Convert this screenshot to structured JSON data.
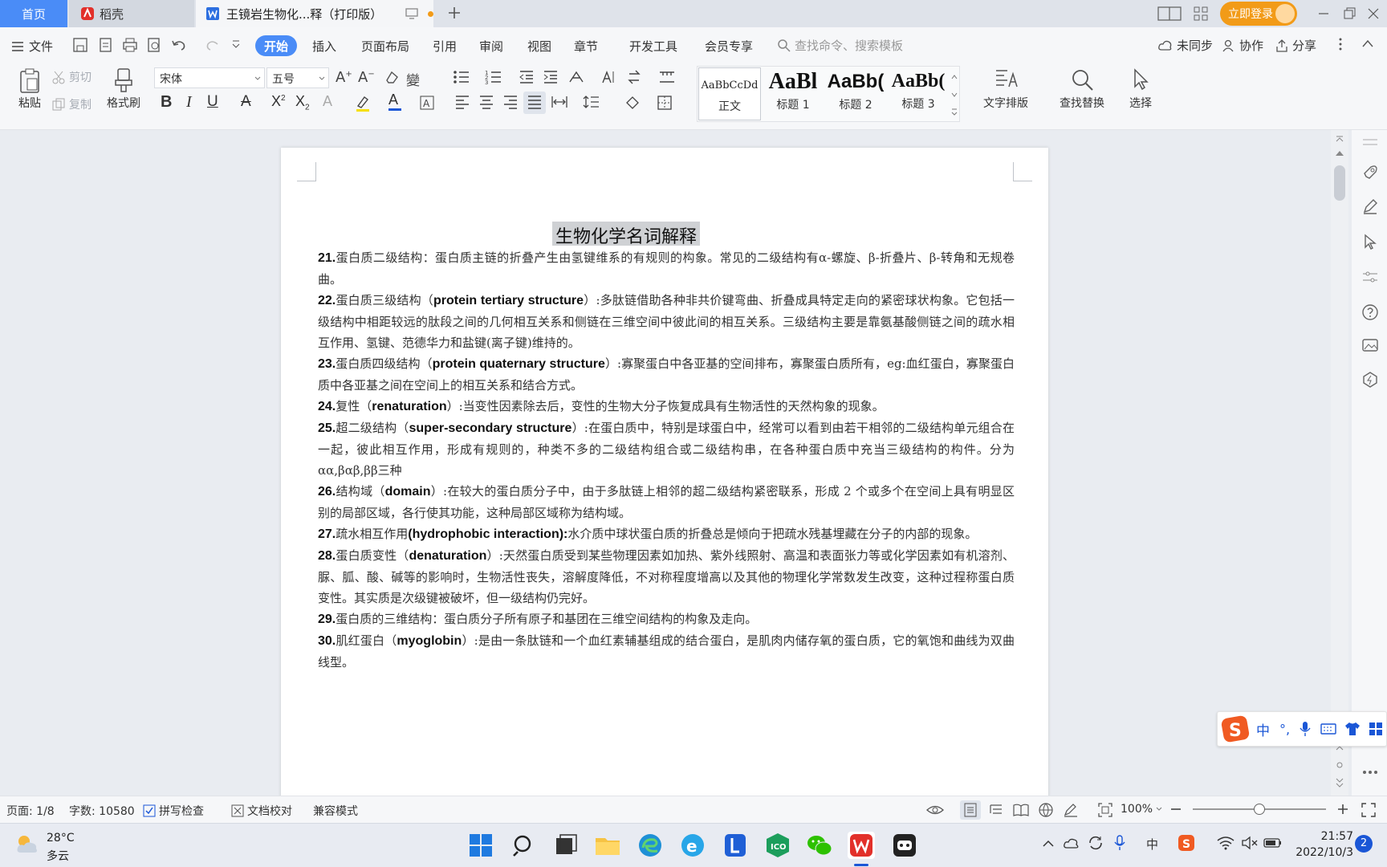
{
  "tabs": {
    "home": "首页",
    "daoke": "稻壳",
    "doc": "王镜岩生物化...释（打印版）",
    "login": "立即登录"
  },
  "menu": {
    "file": "文件",
    "items": [
      "开始",
      "插入",
      "页面布局",
      "引用",
      "审阅",
      "视图",
      "章节",
      "开发工具",
      "会员专享"
    ],
    "search_placeholder": "查找命令、搜索模板",
    "sync": "未同步",
    "collab": "协作",
    "share": "分享"
  },
  "ribbon": {
    "paste": "粘贴",
    "cut": "剪切",
    "copy": "复制",
    "format_painter": "格式刷",
    "font": "宋体",
    "size": "五号",
    "styles": [
      {
        "preview": "AaBbCcDd",
        "label": "正文"
      },
      {
        "preview": "AaBl",
        "label": "标题 1"
      },
      {
        "preview": "AaBb(",
        "label": "标题 2"
      },
      {
        "preview": "AaBb(",
        "label": "标题 3"
      }
    ],
    "text_layout": "文字排版",
    "find_replace": "查找替换",
    "select": "选择"
  },
  "document": {
    "title": "生物化学名词解释",
    "paragraphs": [
      {
        "num": "21.",
        "term": "蛋白质二级结构：",
        "en": "",
        "text": "蛋白质主链的折叠产生由氢键维系的有规则的构象。常见的二级结构有α-螺旋、β-折叠片、β-转角和无规卷曲。"
      },
      {
        "num": "22.",
        "term": "蛋白质三级结构（",
        "en": "protein tertiary structure",
        "text": "）:多肽链借助各种非共价键弯曲、折叠成具特定走向的紧密球状构象。它包括一级结构中相距较远的肽段之间的几何相互关系和侧链在三维空间中彼此间的相互关系。三级结构主要是靠氨基酸侧链之间的疏水相互作用、氢键、范德华力和盐键(离子键)维持的。"
      },
      {
        "num": "23.",
        "term": "蛋白质四级结构（",
        "en": "protein quaternary structure",
        "text": "）:寡聚蛋白中各亚基的空间排布，寡聚蛋白质所有，eg:血红蛋白，寡聚蛋白质中各亚基之间在空间上的相互关系和结合方式。"
      },
      {
        "num": "24.",
        "term": "复性（",
        "en": "renaturation",
        "text": "）:当变性因素除去后，变性的生物大分子恢复成具有生物活性的天然构象的现象。"
      },
      {
        "num": "25.",
        "term": "超二级结构（",
        "en": "super-secondary structure",
        "text": "）:在蛋白质中，特别是球蛋白中，经常可以看到由若干相邻的二级结构单元组合在一起，彼此相互作用，形成有规则的，种类不多的二级结构组合或二级结构串，在各种蛋白质中充当三级结构的构件。分为αα,βαβ,ββ三种"
      },
      {
        "num": "26.",
        "term": "结构域（",
        "en": "domain",
        "text": "）:在较大的蛋白质分子中，由于多肽链上相邻的超二级结构紧密联系，形成 2 个或多个在空间上具有明显区别的局部区域，各行使其功能，这种局部区域称为结构域。"
      },
      {
        "num": "27.",
        "term": "疏水相互作用",
        "en": "(hydrophobic interaction):",
        "text": "水介质中球状蛋白质的折叠总是倾向于把疏水残基埋藏在分子的内部的现象。"
      },
      {
        "num": "28.",
        "term": "蛋白质变性（",
        "en": "denaturation",
        "text": "）:天然蛋白质受到某些物理因素如加热、紫外线照射、高温和表面张力等或化学因素如有机溶剂、脲、胍、酸、碱等的影响时，生物活性丧失，溶解度降低，不对称程度增高以及其他的物理化学常数发生改变，这种过程称蛋白质变性。其实质是次级键被破坏，但一级结构仍完好。"
      },
      {
        "num": "29.",
        "term": "蛋白质的三维结构：",
        "en": "",
        "text": "蛋白质分子所有原子和基团在三维空间结构的构象及走向。"
      },
      {
        "num": "30.",
        "term": "肌红蛋白（",
        "en": "myoglobin",
        "text": "）:是由一条肽链和一个血红素辅基组成的结合蛋白，是肌肉内储存氧的蛋白质，它的氧饱和曲线为双曲线型。"
      }
    ]
  },
  "status": {
    "page": "页面: 1/8",
    "words": "字数: 10580",
    "spell": "拼写检查",
    "proof": "文档校对",
    "compat": "兼容模式",
    "zoom": "100%",
    "zoom_level": 0.5
  },
  "ime": {
    "mode": "中"
  },
  "taskbar": {
    "temp": "28°C",
    "weather": "多云",
    "time": "21:57",
    "date": "2022/10/3",
    "ime_lang": "中",
    "notif": "2"
  },
  "colors": {
    "accent": "#4a8cf7",
    "login": "#f29b18",
    "wps_red": "#e2302a"
  }
}
